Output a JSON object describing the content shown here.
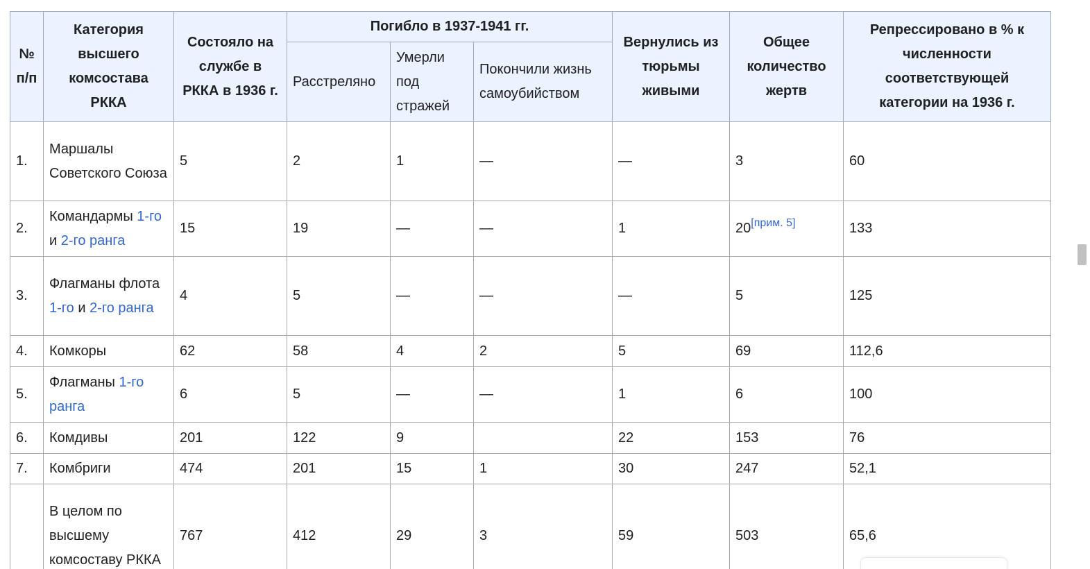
{
  "table": {
    "header": {
      "num": "№ п/п",
      "category": "Категория высшего комсостава РККА",
      "served": "Состояло на службе в РККА в 1936 г.",
      "killed_group": "Погибло в 1937-1941 гг.",
      "shot": "Расстреляно",
      "died_custody": "Умерли под стражей",
      "suicide": "Покончили жизнь самоубийством",
      "returned": "Вернулись из тюрьмы живыми",
      "victims": "Общее количество жертв",
      "percent": "Репрессировано в % к численности соответствующей категории на 1936 г."
    },
    "rows": [
      {
        "num": "1.",
        "category": {
          "prefix": "Маршалы Советского Союза"
        },
        "served": "5",
        "shot": "2",
        "died": "1",
        "suicide": "—",
        "returned": "—",
        "victims": "3",
        "percent": "60"
      },
      {
        "num": "2.",
        "category": {
          "prefix": "Командармы ",
          "link1": "1-го",
          "mid": " и ",
          "link2": "2-го ранга"
        },
        "served": "15",
        "shot": "19",
        "died": "—",
        "suicide": "—",
        "returned": "1",
        "victims": "20",
        "victims_ref": "[прим. 5]",
        "percent": "133"
      },
      {
        "num": "3.",
        "category": {
          "prefix": "Флагманы флота ",
          "link1": "1-го",
          "mid": " и ",
          "link2": "2-го ранга"
        },
        "served": "4",
        "shot": "5",
        "died": "—",
        "suicide": "—",
        "returned": "—",
        "victims": "5",
        "percent": "125"
      },
      {
        "num": "4.",
        "category": {
          "prefix": "Комкоры"
        },
        "served": "62",
        "shot": "58",
        "died": "4",
        "suicide": "2",
        "returned": "5",
        "victims": "69",
        "percent": "112,6"
      },
      {
        "num": "5.",
        "category": {
          "prefix": "Флагманы ",
          "link1": "1-го ранга"
        },
        "served": "6",
        "shot": "5",
        "died": "—",
        "suicide": "—",
        "returned": "1",
        "victims": "6",
        "percent": "100"
      },
      {
        "num": "6.",
        "category": {
          "prefix": "Комдивы"
        },
        "served": "201",
        "shot": "122",
        "died": "9",
        "suicide": "",
        "returned": "22",
        "victims": "153",
        "percent": "76"
      },
      {
        "num": "7.",
        "category": {
          "prefix": "Комбриги"
        },
        "served": "474",
        "shot": "201",
        "died": "15",
        "suicide": "1",
        "returned": "30",
        "victims": "247",
        "percent": "52,1"
      },
      {
        "num": "",
        "category": {
          "prefix": "В целом по высшему комсоставу РККА"
        },
        "served": "767",
        "shot": "412",
        "died": "29",
        "suicide": "3",
        "returned": "59",
        "victims": "503",
        "percent": "65,6"
      }
    ]
  }
}
